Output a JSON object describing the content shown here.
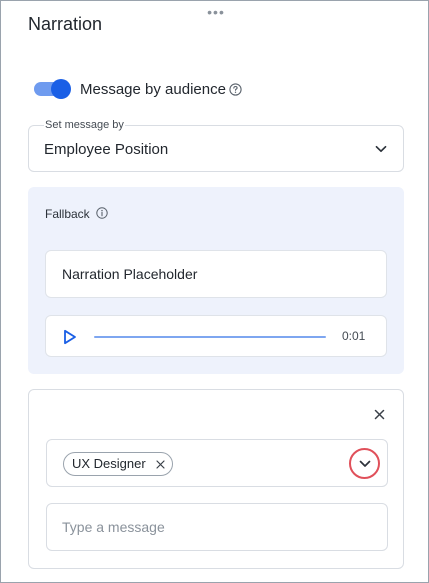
{
  "panel": {
    "title": "Narration",
    "drag_handle": "•••"
  },
  "audience_toggle": {
    "label": "Message by audience",
    "enabled": true,
    "help_icon": "question-circle-icon"
  },
  "set_message_by": {
    "caption": "Set message by",
    "value": "Employee Position",
    "chevron_icon": "chevron-down-icon"
  },
  "fallback": {
    "label": "Fallback",
    "info_icon": "info-circle-icon",
    "narration_text": "Narration Placeholder",
    "audio": {
      "play_icon": "play-icon",
      "time": "0:01",
      "progress": 0
    }
  },
  "audience_message": {
    "close_icon": "close-icon",
    "tags": [
      "UX Designer"
    ],
    "tag_remove_icon": "close-icon",
    "dropdown_icon": "chevron-down-icon",
    "message_placeholder": "Type a message",
    "message_value": ""
  },
  "colors": {
    "accent": "#1a5fe6",
    "accent_light": "#6f9bef",
    "fallback_bg": "#eef2fc",
    "highlight_ring": "#e0505a"
  }
}
